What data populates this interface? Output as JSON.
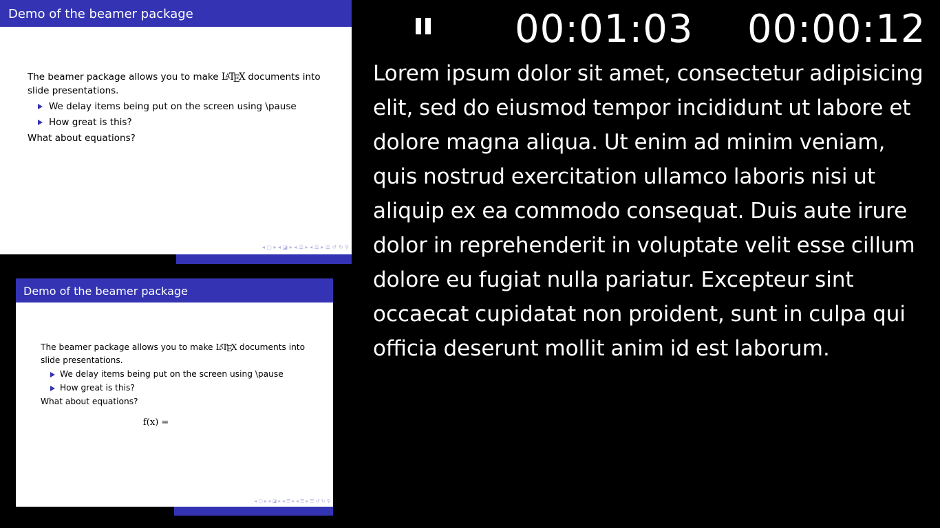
{
  "current_slide": {
    "title": "Demo of the beamer package",
    "intro_before": "The beamer package allows you to make ",
    "latex_logo": "LaTeX",
    "intro_after": " documents into slide presentations.",
    "bullets": [
      "We delay items being put on the screen using \\pause",
      "How great is this?"
    ],
    "question": "What about equations?"
  },
  "next_slide": {
    "title": "Demo of the beamer package",
    "intro_before": "The beamer package allows you to make ",
    "latex_logo": "LaTeX",
    "intro_after": " documents into slide presentations.",
    "bullets": [
      "We delay items being put on the screen using \\pause",
      "How great is this?"
    ],
    "question": "What about equations?",
    "equation": "f(x) ="
  },
  "navigation_symbols": "◂ ▢ ▸  ◂ ◪ ▸  ◂ ☰ ▸  ◂ ☰ ▸   ☰   ↺ ↻ ⚲",
  "timer": {
    "pause_icon": "pause-icon",
    "elapsed": "00:01:03",
    "clock": "00:00:12"
  },
  "notes": "Lorem ipsum dolor sit amet, consectetur adipisicing elit, sed do eiusmod tempor incididunt ut labore et dolore magna aliqua. Ut enim ad minim veniam, quis nostrud exercitation ullamco laboris nisi ut aliquip ex ea commodo consequat. Duis aute irure dolor in reprehenderit in voluptate velit esse cillum dolore eu fugiat nulla pariatur. Excepteur sint occaecat cupidatat non proident, sunt in culpa qui officia deserunt mollit anim id est laborum.",
  "colors": {
    "beamer_blue": "#3333b3",
    "background": "#000000",
    "text": "#ffffff"
  }
}
